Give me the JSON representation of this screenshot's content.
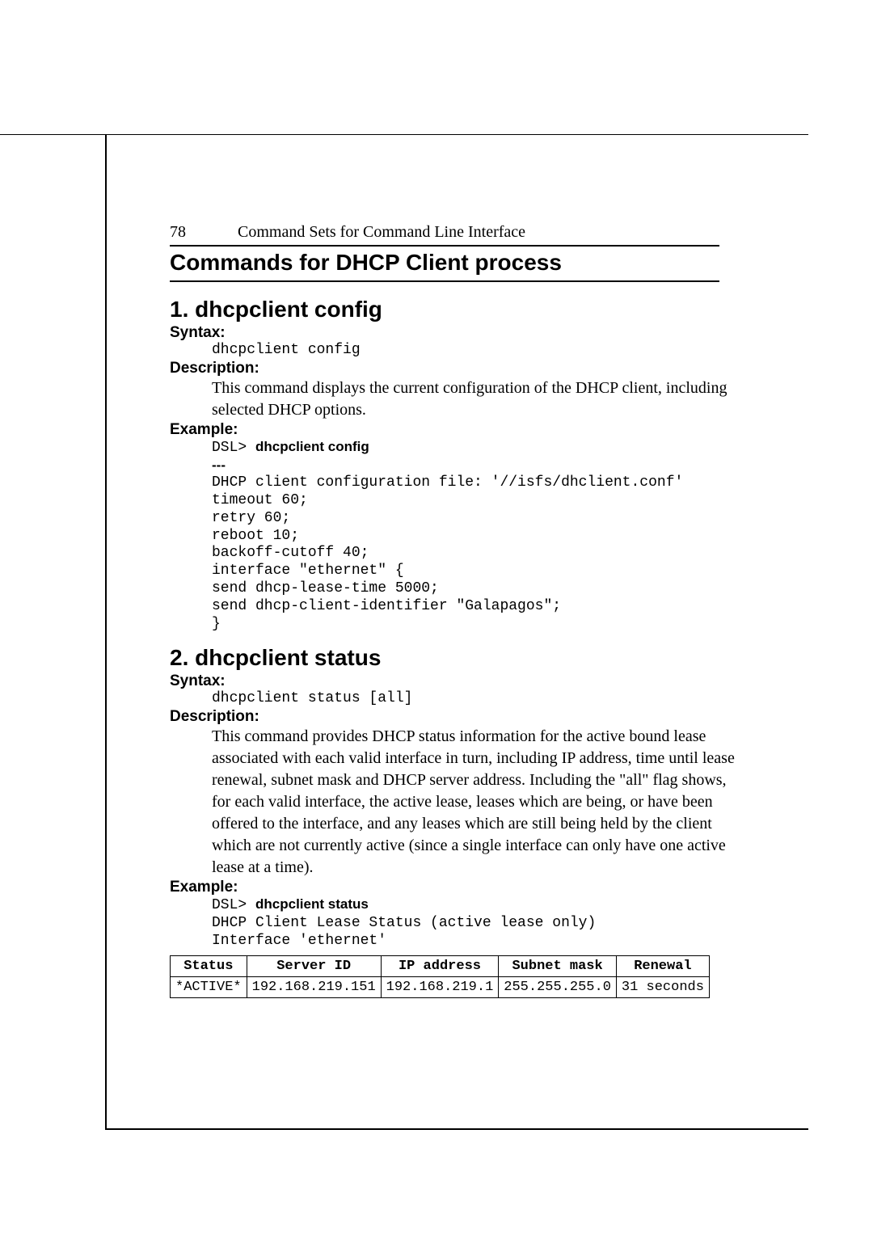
{
  "page_number": "78",
  "header_title": "Command Sets for Command Line Interface",
  "section_title": "Commands for DHCP Client process",
  "cmd1": {
    "title": "1.  dhcpclient config",
    "syntax_label": "Syntax:",
    "syntax": "dhcpclient config",
    "description_label": "Description:",
    "description": "This command displays the current configuration of the DHCP client, including selected DHCP options.",
    "example_label": "Example:",
    "example_prompt": "DSL> ",
    "example_cmd": "dhcpclient config",
    "example_sep": "---",
    "example_lines": [
      "DHCP client configuration file: '//isfs/dhclient.conf'",
      "timeout 60;",
      "retry 60;",
      "reboot 10;",
      "backoff-cutoff 40;",
      "interface \"ethernet\" {",
      "send dhcp-lease-time 5000;",
      "send dhcp-client-identifier \"Galapagos\";",
      "}"
    ]
  },
  "cmd2": {
    "title": "2.  dhcpclient status",
    "syntax_label": "Syntax:",
    "syntax": "dhcpclient status [all]",
    "description_label": "Description:",
    "description": "This command provides DHCP status information for the active bound lease associated with each valid interface in turn, including IP address, time until lease renewal, subnet mask and DHCP server address. Including the \"all\" flag shows, for each valid interface, the active lease, leases which are being, or have been offered to the interface, and any leases which are still being held by the client which are not currently active (since a single interface can only have one active lease at a time).",
    "example_label": "Example:",
    "example_prompt": "DSL> ",
    "example_cmd": "dhcpclient status",
    "example_lines": [
      "DHCP Client Lease Status (active lease only)",
      "Interface 'ethernet'"
    ],
    "table": {
      "headers": [
        "Status",
        "Server ID",
        "IP address",
        "Subnet mask",
        "Renewal"
      ],
      "row": [
        "*ACTIVE*",
        "192.168.219.151",
        "192.168.219.1",
        "255.255.255.0",
        "31 seconds"
      ]
    }
  }
}
